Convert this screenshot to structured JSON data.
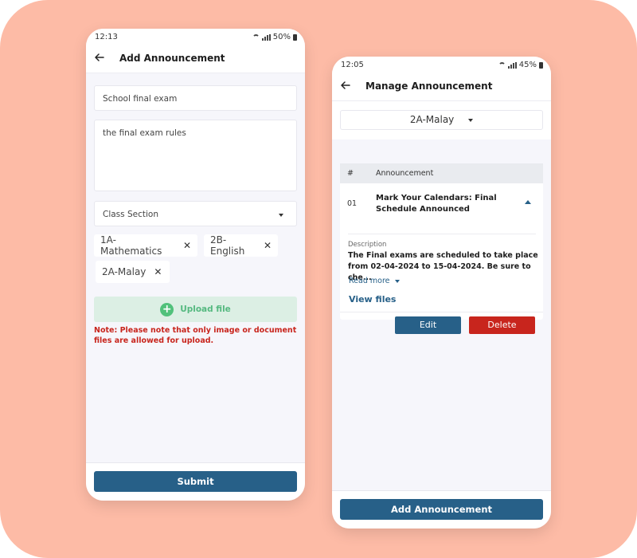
{
  "colors": {
    "background": "#fdbba6",
    "primary": "#276088",
    "danger": "#c8251d",
    "success": "#51c17b",
    "upload_bg": "#dcefe4"
  },
  "add_screen": {
    "status": {
      "time": "12:13",
      "battery": "50%"
    },
    "title": "Add Announcement",
    "back_icon": "arrow-left-icon",
    "title_field": {
      "value": "School final exam"
    },
    "description_field": {
      "value": "the final exam rules"
    },
    "class_section": {
      "placeholder": "Class Section"
    },
    "selected_classes": [
      {
        "label": "1A-Mathematics"
      },
      {
        "label": "2B-English"
      },
      {
        "label": "2A-Malay"
      }
    ],
    "upload_label": "Upload file",
    "note": "Note: Please note that only image or document files are allowed for upload.",
    "submit_label": "Submit"
  },
  "manage_screen": {
    "status": {
      "time": "12:05",
      "battery": "45%"
    },
    "title": "Manage Announcement",
    "class_filter": "2A-Malay",
    "table": {
      "headers": [
        "#",
        "Announcement"
      ],
      "rows": [
        {
          "number": "01",
          "title": "Mark Your Calendars: Final Schedule Announced",
          "description_label": "Description",
          "description": "The Final exams are scheduled to take place from 02-04-2024 to 15-04-2024. Be sure to che...",
          "read_more": "Read more",
          "view_files": "View files"
        }
      ]
    },
    "edit_label": "Edit",
    "delete_label": "Delete",
    "add_button_label": "Add Announcement"
  }
}
